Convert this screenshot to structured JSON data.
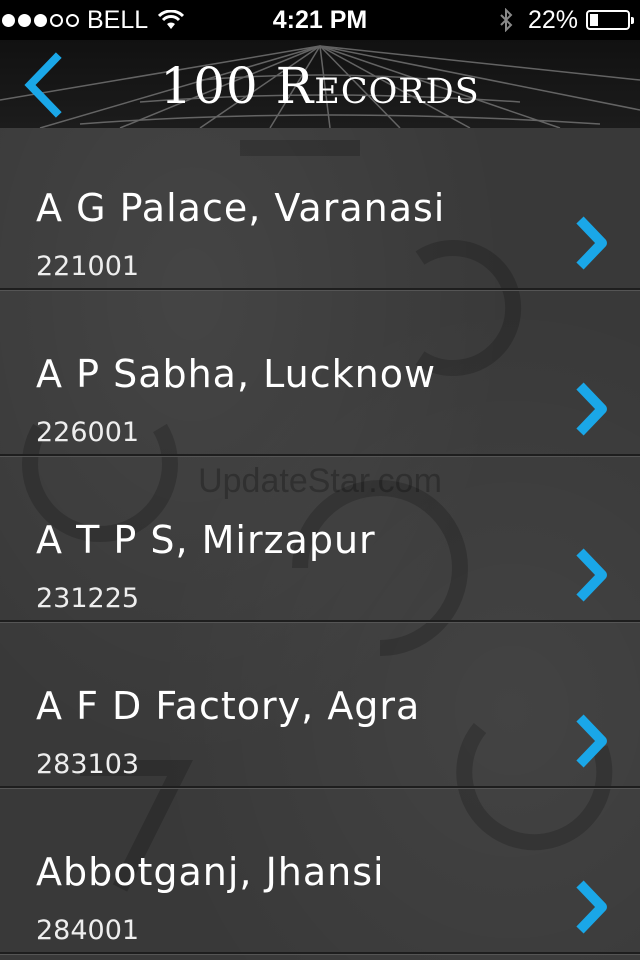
{
  "status_bar": {
    "carrier": "BELL",
    "time": "4:21 PM",
    "battery": "22%",
    "signal_bars_filled": 3,
    "signal_bars_total": 5
  },
  "nav": {
    "title": "100 Records",
    "back_icon": "chevron-left-icon",
    "accent_color": "#1aa7e8"
  },
  "records": [
    {
      "name": "A G Palace, Varanasi",
      "pin": "221001"
    },
    {
      "name": "A P Sabha, Lucknow",
      "pin": "226001"
    },
    {
      "name": "A T P S, Mirzapur",
      "pin": "231225"
    },
    {
      "name": "A F D Factory, Agra",
      "pin": "283103"
    },
    {
      "name": "Abbotganj, Jhansi",
      "pin": "284001"
    }
  ],
  "watermark": "UpdateStar.com"
}
